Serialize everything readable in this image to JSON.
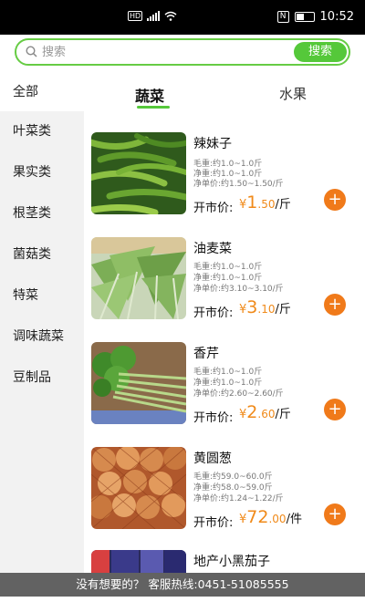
{
  "status_bar": {
    "time": "10:52",
    "hd_label": "HD",
    "nfc_label": "N"
  },
  "search": {
    "placeholder": "搜索",
    "button_label": "搜索",
    "accent": "#55c83a"
  },
  "sidebar": {
    "all_label": "全部",
    "items": [
      {
        "label": "叶菜类"
      },
      {
        "label": "果实类"
      },
      {
        "label": "根茎类"
      },
      {
        "label": "菌菇类"
      },
      {
        "label": "特菜"
      },
      {
        "label": "调味蔬菜"
      },
      {
        "label": "豆制品"
      }
    ]
  },
  "tabs": [
    {
      "label": "蔬菜",
      "active": true
    },
    {
      "label": "水果",
      "active": false
    }
  ],
  "price_label": "开市价:",
  "currency": "¥",
  "price_color": "#f08a1a",
  "products": [
    {
      "name": "辣妹子",
      "gross": "毛重:约1.0~1.0斤",
      "net": "净重:约1.0~1.0斤",
      "unit_price": "净单价:约1.50~1.50/斤",
      "price_int": "1",
      "price_dec": ".50",
      "unit": "/斤"
    },
    {
      "name": "油麦菜",
      "gross": "毛重:约1.0~1.0斤",
      "net": "净重:约1.0~1.0斤",
      "unit_price": "净单价:约3.10~3.10/斤",
      "price_int": "3",
      "price_dec": ".10",
      "unit": "/斤"
    },
    {
      "name": "香芹",
      "gross": "毛重:约1.0~1.0斤",
      "net": "净重:约1.0~1.0斤",
      "unit_price": "净单价:约2.60~2.60/斤",
      "price_int": "2",
      "price_dec": ".60",
      "unit": "/斤"
    },
    {
      "name": "黄圆葱",
      "gross": "毛重:约59.0~60.0斤",
      "net": "净重:约58.0~59.0斤",
      "unit_price": "净单价:约1.24~1.22/斤",
      "price_int": "72",
      "price_dec": ".00",
      "unit": "/件"
    },
    {
      "name": "地产小黑茄子"
    }
  ],
  "footer": {
    "text": "没有想要的？ 客服热线:0451-51085555"
  }
}
